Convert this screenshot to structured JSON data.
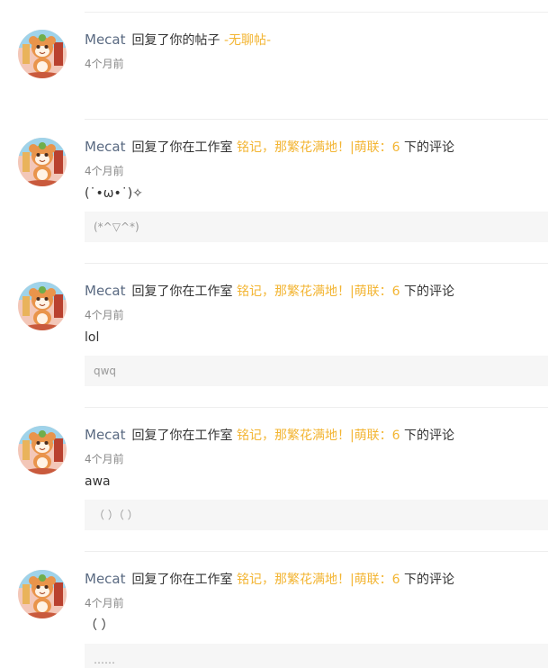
{
  "notifications": [
    {
      "username": "Mecat",
      "action": "回复了你的帖子",
      "target": "-无聊帖-",
      "suffix": "",
      "time": "4个月前",
      "content": "",
      "quote": ""
    },
    {
      "username": "Mecat",
      "action": "回复了你在工作室",
      "target": "铭记，那繁花满地！|萌联：6",
      "suffix": "下的评论",
      "time": "4个月前",
      "content": "(˙•ω•˙)✧",
      "quote": "(*^▽^*)"
    },
    {
      "username": "Mecat",
      "action": "回复了你在工作室",
      "target": "铭记，那繁花满地！|萌联：6",
      "suffix": "下的评论",
      "time": "4个月前",
      "content": "lol",
      "quote": "qwq"
    },
    {
      "username": "Mecat",
      "action": "回复了你在工作室",
      "target": "铭记，那繁花满地！|萌联：6",
      "suffix": "下的评论",
      "time": "4个月前",
      "content": "awa",
      "quote": "（ ）（ ）"
    },
    {
      "username": "Mecat",
      "action": "回复了你在工作室",
      "target": "铭记，那繁花满地！|萌联：6",
      "suffix": "下的评论",
      "time": "4个月前",
      "content": "（ ）",
      "quote": "……"
    }
  ],
  "colors": {
    "username": "#5a6a82",
    "link": "#f3b533",
    "text": "#333333",
    "time": "#888888",
    "quote_bg": "#f6f6f6",
    "divider": "#eeeeee"
  },
  "icons": {
    "avatar": "cat-avatar-icon"
  }
}
